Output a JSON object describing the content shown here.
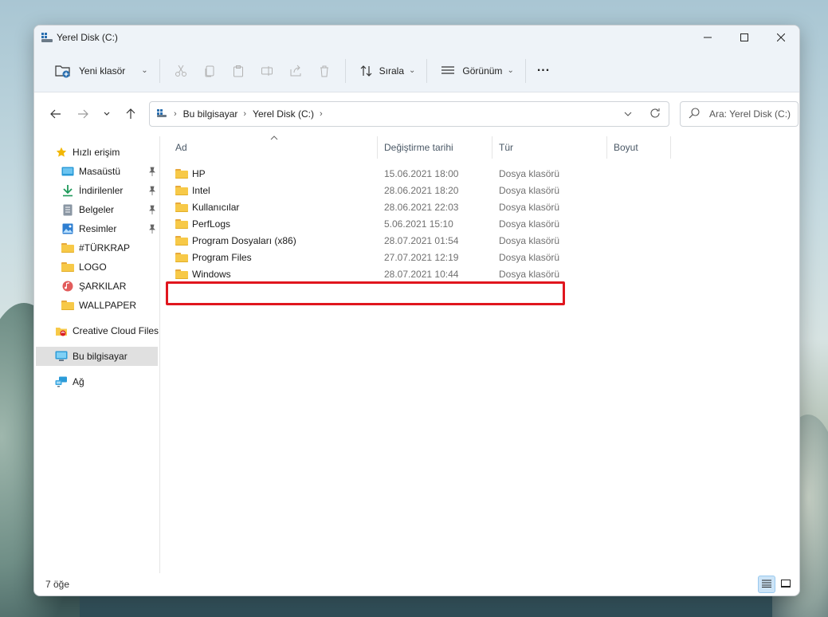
{
  "window": {
    "title": "Yerel Disk (C:)"
  },
  "toolbar": {
    "new_folder_label": "Yeni klasör",
    "sort_label": "Sırala",
    "view_label": "Görünüm",
    "more_label": "..."
  },
  "address": {
    "crumbs": [
      "Bu bilgisayar",
      "Yerel Disk (C:)"
    ]
  },
  "search": {
    "placeholder": "Ara: Yerel Disk (C:)"
  },
  "sidebar": {
    "quick_access": "Hızlı erişim",
    "quick_items": [
      {
        "label": "Masaüstü",
        "icon": "desktop-icon",
        "pinned": true
      },
      {
        "label": "İndirilenler",
        "icon": "download-icon",
        "pinned": true
      },
      {
        "label": "Belgeler",
        "icon": "documents-icon",
        "pinned": true
      },
      {
        "label": "Resimler",
        "icon": "pictures-icon",
        "pinned": true
      },
      {
        "label": "#TÜRKRAP",
        "icon": "folder-icon",
        "pinned": false
      },
      {
        "label": "LOGO",
        "icon": "folder-icon",
        "pinned": false
      },
      {
        "label": "ŞARKILAR",
        "icon": "music-icon",
        "pinned": false
      },
      {
        "label": "WALLPAPER",
        "icon": "folder-icon",
        "pinned": false
      }
    ],
    "creative_cloud": "Creative Cloud Files",
    "this_pc": "Bu bilgisayar",
    "network": "Ağ"
  },
  "columns": {
    "name": "Ad",
    "modified": "Değiştirme tarihi",
    "type": "Tür",
    "size": "Boyut"
  },
  "files": [
    {
      "name": "HP",
      "modified": "15.06.2021 18:00",
      "type": "Dosya klasörü"
    },
    {
      "name": "Intel",
      "modified": "28.06.2021 18:20",
      "type": "Dosya klasörü"
    },
    {
      "name": "Kullanıcılar",
      "modified": "28.06.2021 22:03",
      "type": "Dosya klasörü"
    },
    {
      "name": "PerfLogs",
      "modified": "5.06.2021 15:10",
      "type": "Dosya klasörü"
    },
    {
      "name": "Program Dosyaları (x86)",
      "modified": "28.07.2021 01:54",
      "type": "Dosya klasörü"
    },
    {
      "name": "Program Files",
      "modified": "27.07.2021 12:19",
      "type": "Dosya klasörü"
    },
    {
      "name": "Windows",
      "modified": "28.07.2021 10:44",
      "type": "Dosya klasörü"
    }
  ],
  "status": {
    "item_count": "7 öğe"
  },
  "colors": {
    "highlight": "#e0161e",
    "folder": "#f7c948",
    "selected_nav": "#e0e0e0"
  }
}
